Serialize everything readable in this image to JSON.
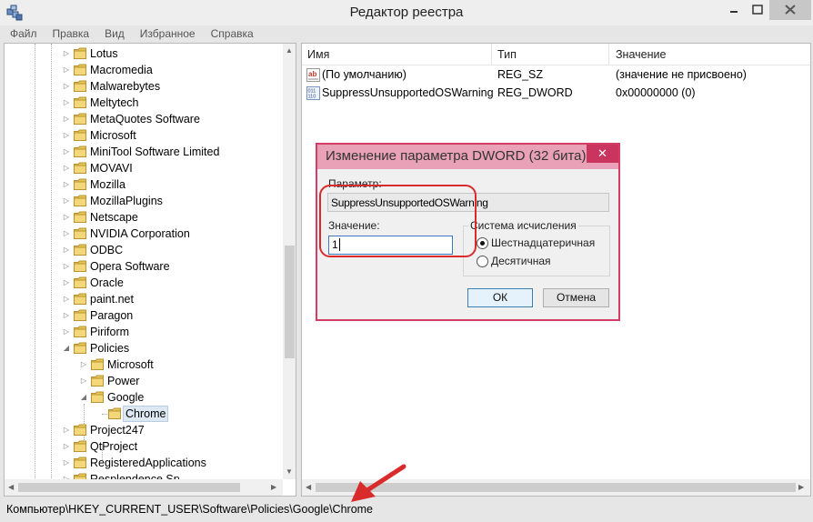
{
  "window": {
    "title": "Редактор реестра",
    "controls": {
      "minimize": "–",
      "maximize": "□",
      "close": "✕"
    }
  },
  "menu": [
    "Файл",
    "Правка",
    "Вид",
    "Избранное",
    "Справка"
  ],
  "tree": {
    "items": [
      {
        "label": "Lotus",
        "level": 1,
        "expander": "collapsed"
      },
      {
        "label": "Macromedia",
        "level": 1,
        "expander": "collapsed"
      },
      {
        "label": "Malwarebytes",
        "level": 1,
        "expander": "collapsed"
      },
      {
        "label": "Meltytech",
        "level": 1,
        "expander": "collapsed"
      },
      {
        "label": "MetaQuotes Software",
        "level": 1,
        "expander": "collapsed"
      },
      {
        "label": "Microsoft",
        "level": 1,
        "expander": "collapsed"
      },
      {
        "label": "MiniTool Software Limited",
        "level": 1,
        "expander": "collapsed"
      },
      {
        "label": "MOVAVI",
        "level": 1,
        "expander": "collapsed"
      },
      {
        "label": "Mozilla",
        "level": 1,
        "expander": "collapsed"
      },
      {
        "label": "MozillaPlugins",
        "level": 1,
        "expander": "collapsed"
      },
      {
        "label": "Netscape",
        "level": 1,
        "expander": "collapsed"
      },
      {
        "label": "NVIDIA Corporation",
        "level": 1,
        "expander": "collapsed"
      },
      {
        "label": "ODBC",
        "level": 1,
        "expander": "collapsed"
      },
      {
        "label": "Opera Software",
        "level": 1,
        "expander": "collapsed"
      },
      {
        "label": "Oracle",
        "level": 1,
        "expander": "collapsed"
      },
      {
        "label": "paint.net",
        "level": 1,
        "expander": "collapsed"
      },
      {
        "label": "Paragon",
        "level": 1,
        "expander": "collapsed"
      },
      {
        "label": "Piriform",
        "level": 1,
        "expander": "collapsed"
      },
      {
        "label": "Policies",
        "level": 1,
        "expander": "expanded"
      },
      {
        "label": "Microsoft",
        "level": 2,
        "expander": "collapsed"
      },
      {
        "label": "Power",
        "level": 2,
        "expander": "collapsed"
      },
      {
        "label": "Google",
        "level": 2,
        "expander": "expanded"
      },
      {
        "label": "Chrome",
        "level": 3,
        "expander": "none",
        "selected": true
      },
      {
        "label": "Project247",
        "level": 1,
        "expander": "collapsed"
      },
      {
        "label": "QtProject",
        "level": 1,
        "expander": "collapsed"
      },
      {
        "label": "RegisteredApplications",
        "level": 1,
        "expander": "collapsed"
      },
      {
        "label": "Resplendence Sp",
        "level": 1,
        "expander": "collapsed"
      }
    ]
  },
  "list": {
    "columns": [
      "Имя",
      "Тип",
      "Значение"
    ],
    "rows": [
      {
        "icon": "string-value-icon",
        "name": "(По умолчанию)",
        "type": "REG_SZ",
        "value": "(значение не присвоено)"
      },
      {
        "icon": "dword-value-icon",
        "name": "SuppressUnsupportedOSWarning",
        "type": "REG_DWORD",
        "value": "0x00000000 (0)"
      }
    ]
  },
  "status": {
    "path": "Компьютер\\HKEY_CURRENT_USER\\Software\\Policies\\Google\\Chrome"
  },
  "dialog": {
    "title": "Изменение параметра DWORD (32 бита)",
    "close": "✕",
    "param_label": "Параметр:",
    "param_value": "SuppressUnsupportedOSWarning",
    "value_label": "Значение:",
    "value_input": "1",
    "base_group": "Система исчисления",
    "radio_hex": "Шестнадцатеричная",
    "radio_dec": "Десятичная",
    "selected_base": "hex",
    "ok": "ОК",
    "cancel": "Отмена"
  },
  "colors": {
    "dialog_border": "#d53d69",
    "dialog_titlebar": "#e8a1b6",
    "annotation_red": "#d92b2b",
    "folder_yellow": "#e8c65a"
  }
}
